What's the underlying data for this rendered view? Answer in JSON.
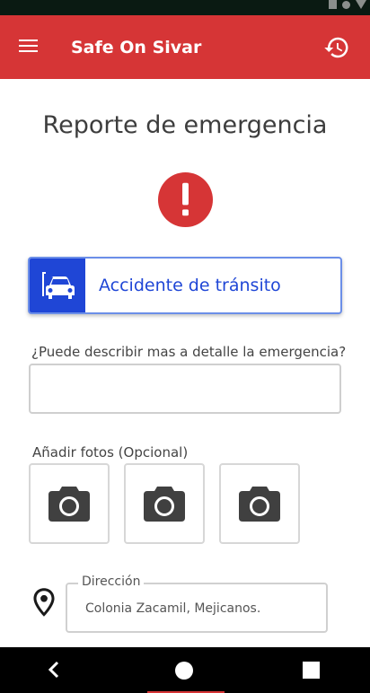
{
  "app": {
    "title": "Safe On Sivar",
    "brand_color": "#d63536",
    "menu_icon": "menu-icon",
    "history_icon": "history-icon"
  },
  "page": {
    "title": "Reporte de emergencia",
    "alert_icon": "exclamation-circle-icon"
  },
  "emergency_type": {
    "label": "Accidente de tránsito",
    "icon": "car-icon",
    "accent_color": "#1f46d6"
  },
  "description": {
    "label": "¿Puede describir mas a detalle la emergencia?",
    "value": ""
  },
  "photos": {
    "label": "Añadir fotos (Opcional)",
    "slots": [
      {
        "icon": "camera-icon"
      },
      {
        "icon": "camera-icon"
      },
      {
        "icon": "camera-icon"
      }
    ]
  },
  "address": {
    "label": "Dirección",
    "value": "Colonia Zacamil, Mejicanos.",
    "icon": "location-pin-icon"
  },
  "system_nav": {
    "back_icon": "back-icon",
    "home_icon": "home-icon",
    "recents_icon": "recents-icon"
  }
}
